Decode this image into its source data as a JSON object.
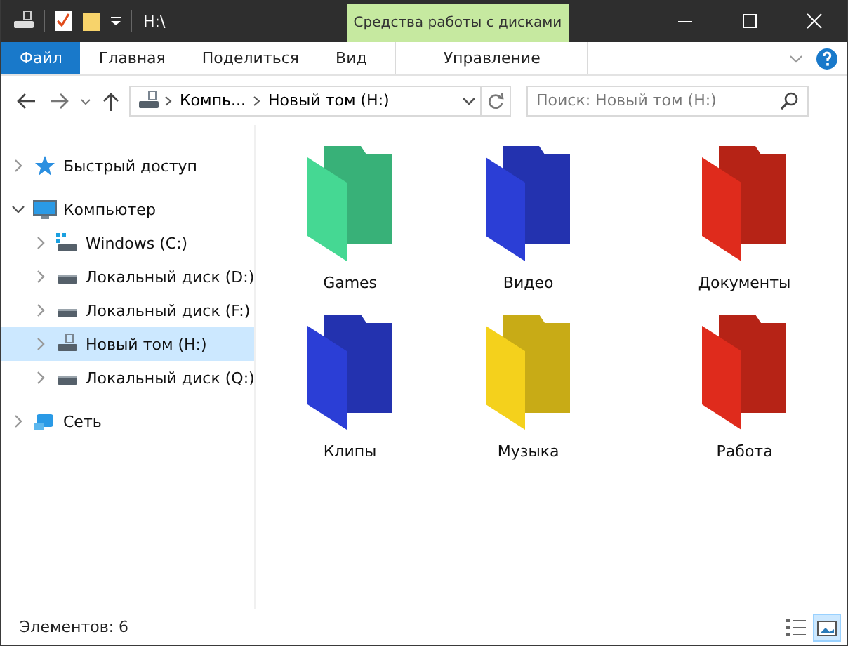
{
  "window": {
    "title": "H:\\",
    "context_group": "Средства работы с дисками"
  },
  "ribbon_tabs": [
    {
      "label": "Файл",
      "kind": "file",
      "selected": false
    },
    {
      "label": "Главная",
      "kind": "tab",
      "selected": false
    },
    {
      "label": "Поделиться",
      "kind": "tab",
      "selected": false
    },
    {
      "label": "Вид",
      "kind": "tab",
      "selected": false
    },
    {
      "label": "Управление",
      "kind": "context",
      "selected": false
    }
  ],
  "address": {
    "crumbs": [
      "Компь...",
      "Новый том (H:)"
    ]
  },
  "search": {
    "placeholder": "Поиск: Новый том (H:)"
  },
  "navigation": [
    {
      "label": "Быстрый доступ",
      "kind": "star",
      "expanded": false,
      "selected": false
    },
    {
      "label": "Компьютер",
      "kind": "computer",
      "expanded": true,
      "selected": false,
      "children": [
        {
          "label": "Windows (C:)",
          "kind": "system-drive",
          "expanded": false,
          "selected": false
        },
        {
          "label": "Локальный диск (D:)",
          "kind": "drive",
          "expanded": false,
          "selected": false
        },
        {
          "label": "Локальный диск (F:)",
          "kind": "drive",
          "expanded": false,
          "selected": false
        },
        {
          "label": "Новый том (H:)",
          "kind": "usb-drive",
          "expanded": false,
          "selected": true
        },
        {
          "label": "Локальный диск (Q:)",
          "kind": "drive",
          "expanded": false,
          "selected": false
        }
      ]
    },
    {
      "label": "Сеть",
      "kind": "network",
      "expanded": false,
      "selected": false
    }
  ],
  "folders": [
    {
      "name": "Games",
      "color": "#45d893"
    },
    {
      "name": "Видео",
      "color": "#2b3ed6"
    },
    {
      "name": "Документы",
      "color": "#df2b1c"
    },
    {
      "name": "Клипы",
      "color": "#2b3ed6"
    },
    {
      "name": "Музыка",
      "color": "#f4d11c"
    },
    {
      "name": "Работа",
      "color": "#df2b1c"
    }
  ],
  "status_bar": {
    "text": "Элементов: 6",
    "views": [
      {
        "kind": "details",
        "selected": false
      },
      {
        "kind": "large-icons",
        "selected": true
      }
    ]
  }
}
